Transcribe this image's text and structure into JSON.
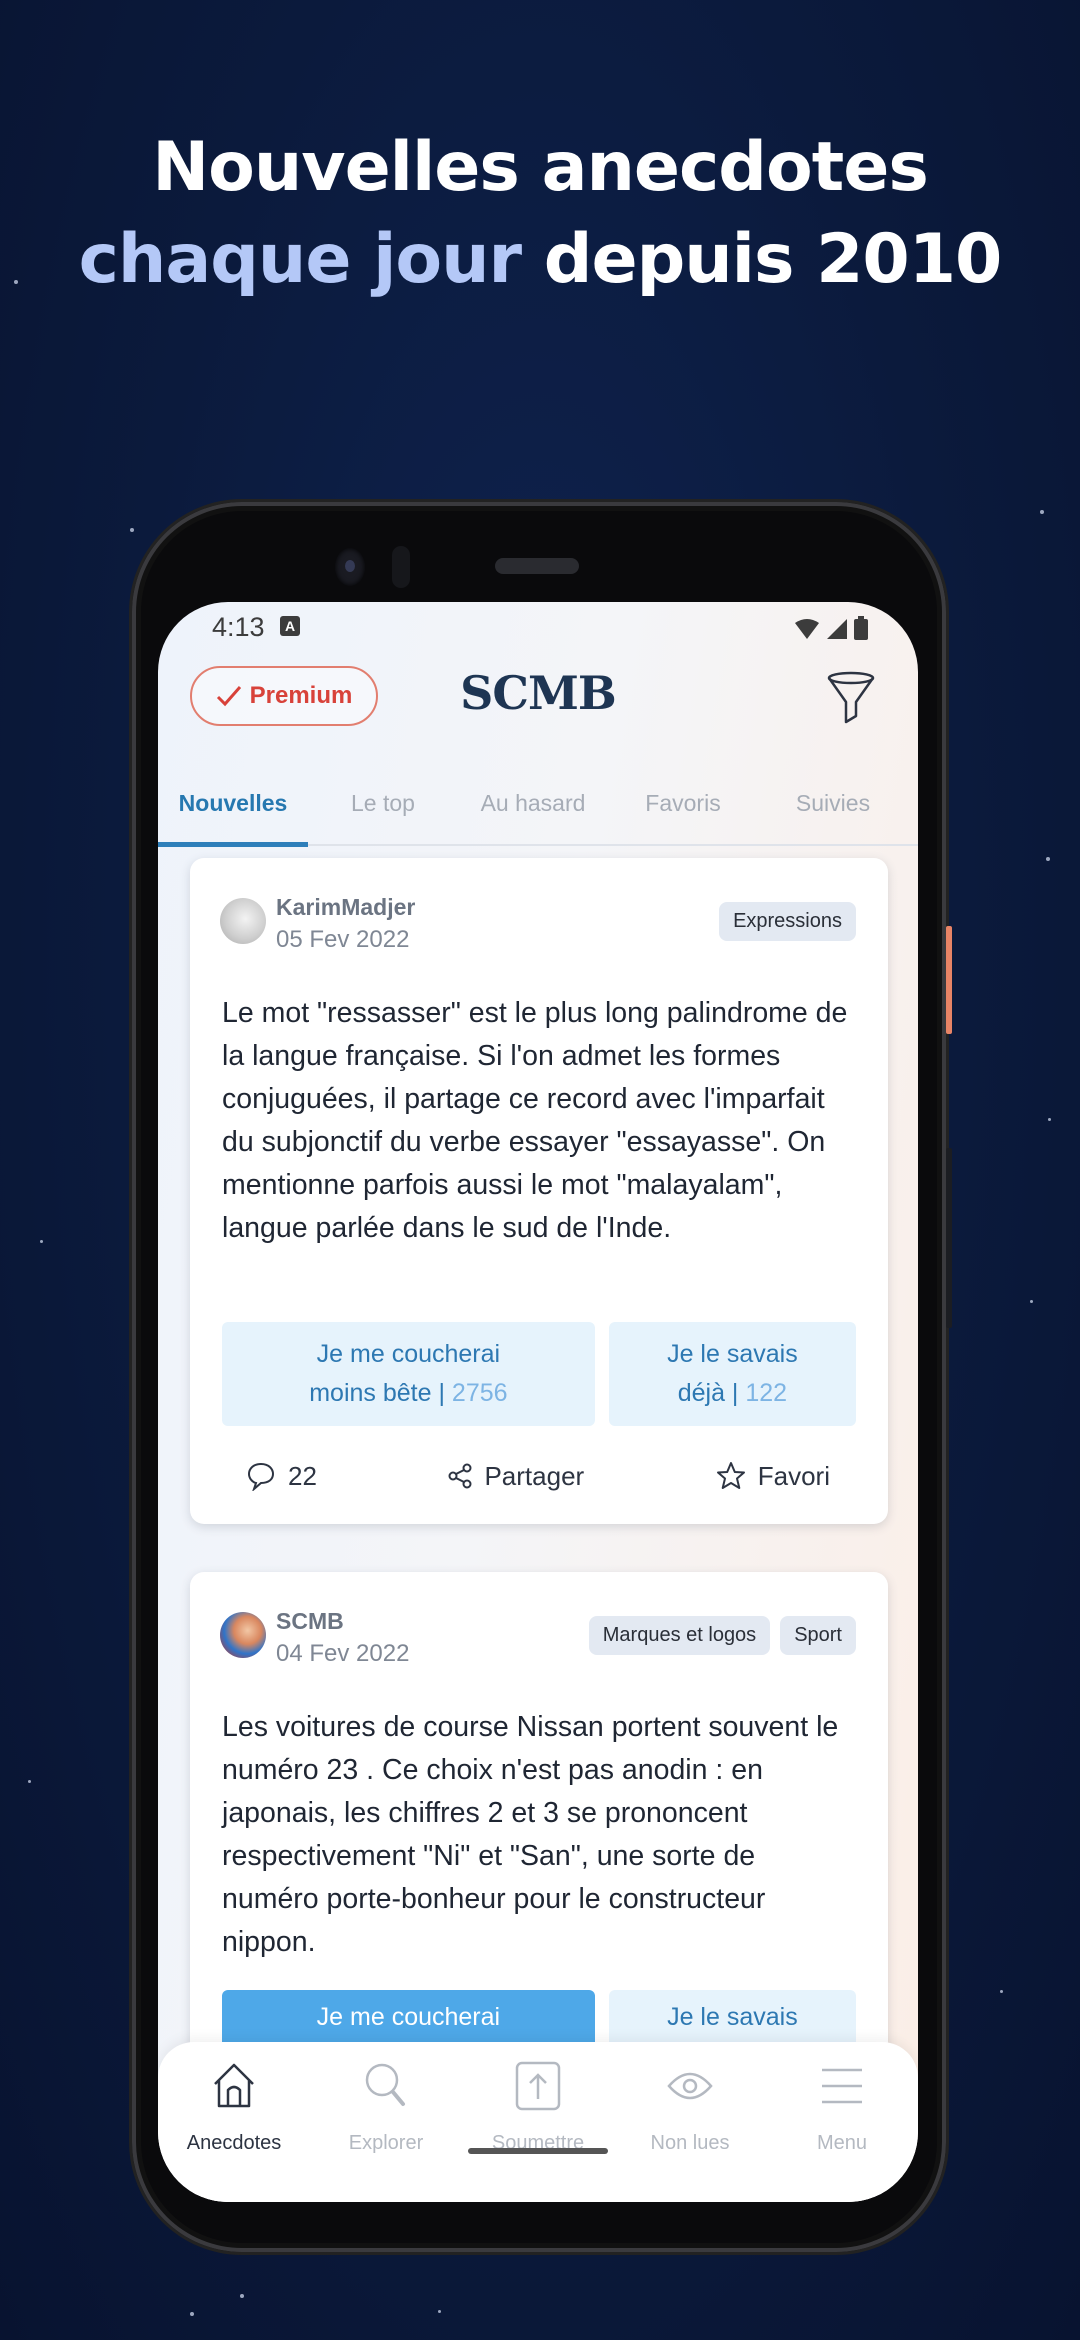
{
  "headline": {
    "line1": "Nouvelles anecdotes",
    "line2_accent": "chaque jour",
    "line2_rest": " depuis 2010",
    "accent_color": "#b4c8f7"
  },
  "status_bar": {
    "time": "4:13",
    "notification_badge": "A",
    "icons": [
      "wifi-icon",
      "signal-icon",
      "battery-icon"
    ]
  },
  "header": {
    "premium_label": "Premium",
    "premium_icon": "check-icon",
    "app_title": "SCMB",
    "filter_icon": "filter-funnel-icon",
    "accent_color": "#d8423a"
  },
  "tabs": [
    {
      "label": "Nouvelles",
      "active": true
    },
    {
      "label": "Le top",
      "active": false
    },
    {
      "label": "Au hasard",
      "active": false
    },
    {
      "label": "Favoris",
      "active": false
    },
    {
      "label": "Suivies",
      "active": false
    }
  ],
  "posts": [
    {
      "author": "KarimMadjer",
      "date": "05 Fev 2022",
      "tags": [
        "Expressions"
      ],
      "text": "Le mot \"ressasser\" est le plus long palindrome de la langue française. Si l'on admet les formes conjuguées, il partage ce record avec l'imparfait du subjonctif du verbe essayer \"essayasse\". On mentionne parfois aussi le mot \"malayalam\", langue parlée dans le sud de l'Inde.",
      "vote_learned": {
        "line1": "Je me coucherai",
        "line2": "moins bête | ",
        "count": "2756"
      },
      "vote_knew": {
        "line1": "Je le savais",
        "line2": "déjà | ",
        "count": "122"
      },
      "comments": "22",
      "share_label": "Partager",
      "favorite_label": "Favori"
    },
    {
      "author": "SCMB",
      "date": "04 Fev 2022",
      "tags": [
        "Marques et logos",
        "Sport"
      ],
      "text": "Les voitures de course Nissan portent souvent le numéro 23 . Ce choix n'est pas anodin : en japonais, les chiffres 2 et 3 se prononcent respectivement \"Ni\" et \"San\", une sorte de numéro porte-bonheur pour le constructeur nippon.",
      "vote_learned": {
        "line1": "Je me coucherai"
      },
      "vote_knew": {
        "line1": "Je le savais"
      }
    }
  ],
  "bottom_nav": [
    {
      "label": "Anecdotes",
      "icon": "home-icon",
      "active": true
    },
    {
      "label": "Explorer",
      "icon": "search-icon",
      "active": false
    },
    {
      "label": "Soumettre",
      "icon": "upload-icon",
      "active": false
    },
    {
      "label": "Non lues",
      "icon": "eye-icon",
      "active": false
    },
    {
      "label": "Menu",
      "icon": "menu-icon",
      "active": false
    }
  ]
}
